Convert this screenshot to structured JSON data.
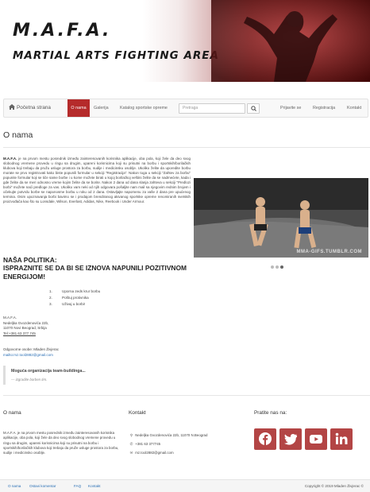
{
  "banner": {
    "title": "M.A.F.A.",
    "subtitle": "MARTIAL ARTS FIGHTING AREA"
  },
  "nav": {
    "home": "Početna strana",
    "active": "O nama",
    "gallery": "Galerija",
    "catalog": "Katalog sportske opreme",
    "search_placeholder": "Pretraga",
    "login": "Prijavite se",
    "register": "Registracija",
    "contact": "Kontakt"
  },
  "page_title": "O nama",
  "intro": {
    "brand": "M.A.F.A.",
    "text": " je na prvom mestu posrednik između zainteresovanih korisnika aplikacije, oba pola, koji žele da deo svog slobodnog vremene provedu u ringu sa drugim, upareni korisnicima koji su prisutni na borbu i sportskih/borilačkih klubova koji trebaju da pružu usluge prostora za borbu, sudije i medicinsku osoblje. Ukoliko želite da uporedite borbu morate se prvo registrovati kako biste popunili formular u sekciji \"Registracija\". Nakon toga u sekciji \"Zahtev za borbu\" popunite formular koji se tiče same borbe i u kome možete birati u kojoj borilačkoj veštini želite da se nadmećete, kada i gde želite da se meri odnosno vreme kojim želite da se borite. Nakon 2 dana od dana slanja zahteva u sekciji \"Predlozi borbi\" možete naći predloge za vas. Ukoliko vam neki od njih odgovara pošaljite nam mail sa njegovim rednim brojem i očekujte potvrdu borbe se naponosme borbu u roku od 2 dana. Ostavljajte napomenu za vaše 2 dana pre upućenog termina. Osim upoznavanja borbi bavimo se i prodajom brendiranog akivanog sportske opreme renomiranih svetskih proizvođača kao što su Lonsdale, Wilson, Everlast, Adidas, Nike, Reebook i Under Armour."
  },
  "slider": {
    "caption": "MMA-GIFS.TUMBLR.COM",
    "slides": 3,
    "active_slide": 3
  },
  "policy": {
    "head": "NAŠA POLITIKA:",
    "text": "ISPRAZNITE SE DA BI SE IZNOVA NAPUNILI POZITIVNOM ENERGIJOM!"
  },
  "rules": [
    {
      "num": "1.",
      "text": "Uporna zeds krur borbu"
    },
    {
      "num": "2.",
      "text": "Poštuj protivnika"
    },
    {
      "num": "3.",
      "text": "Uživaj u borbi!"
    }
  ],
  "address": {
    "name": "M.A.F.A.",
    "street": "Nedeljka Gvozdenovića 22b,",
    "city": "11070 Novi Beograd, Srbija",
    "tel": "Tel:+381 63 377 745"
  },
  "owner": {
    "label": "Odgovorne osobe: Mladen Živjerac",
    "mail": "mailto:mz.tool2882@gmail.com"
  },
  "quote": {
    "line1": "Moguća organizacija team-buildinga...",
    "line2": "— izgradite borben tim."
  },
  "footer": {
    "about_head": "O nama",
    "about_text": "M.A.F.A. je na prvom mestu posrednik između zainteresovanih korisnika aplikacije, oba pola, koji žele da deo svog slobodnog vremene provedu u ringu sa drugim, upareni korisnicima koji su prisutni na borbu i sportskih/borilačkih klubova koji trebaju da pruže usluge prostora za borbu, sudije i medicinsko osoblje.",
    "contact_head": "Kontakt",
    "contact_address": "Nedeljka Gvozdenovića 22b, 11070 N.Beograd",
    "contact_phone": "+381 63 377745",
    "contact_mail": "mz.tool2882@gmail.com",
    "follow_head": "Pratite nas na:",
    "social": [
      "facebook-icon",
      "twitter-icon",
      "youtube-icon",
      "linkedin-icon"
    ]
  },
  "bottom": {
    "links": [
      "O nama",
      "Ostavi komentar",
      "FAQ",
      "Kontakt"
    ],
    "copyright": "Copyright © 2019 Mladen Živjerac ©"
  },
  "colors": {
    "accent": "#b52b2b",
    "social": "#b34545",
    "link": "#2a6fb5"
  }
}
